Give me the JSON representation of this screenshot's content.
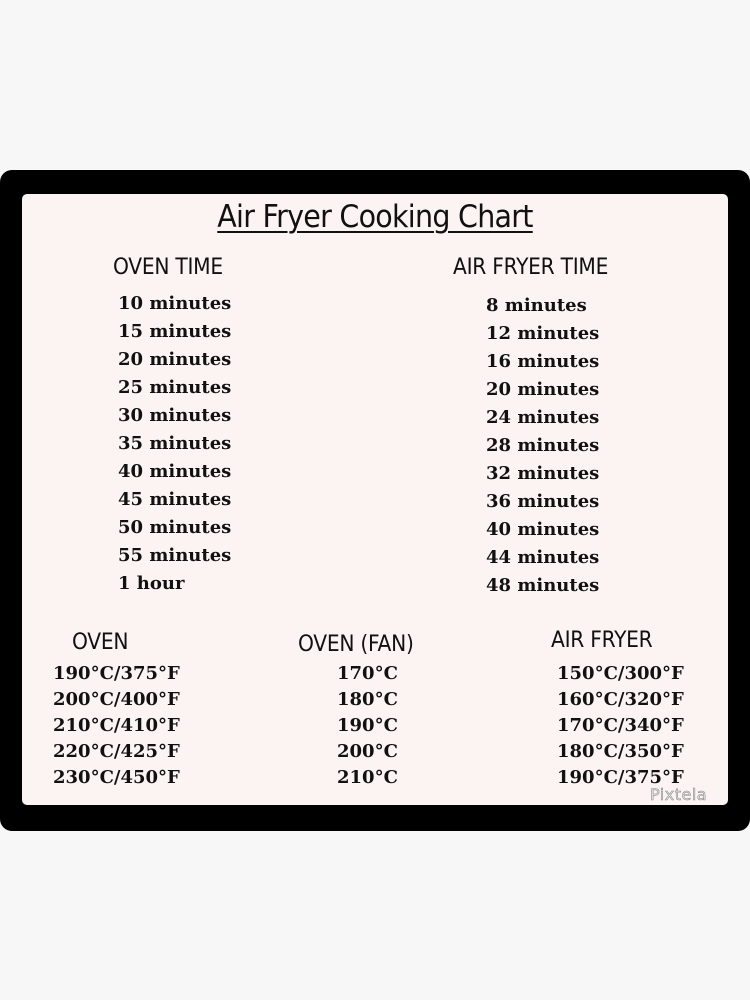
{
  "title": "Air Fryer Cooking Chart",
  "time_section": {
    "oven_heading": "OVEN TIME",
    "air_fryer_heading": "AIR FRYER TIME",
    "oven_times": [
      "10 minutes",
      "15 minutes",
      "20 minutes",
      "25 minutes",
      "30 minutes",
      "35 minutes",
      "40 minutes",
      "45 minutes",
      "50 minutes",
      "55 minutes",
      "1 hour"
    ],
    "air_fryer_times": [
      "8 minutes",
      "12 minutes",
      "16 minutes",
      "20 minutes",
      "24 minutes",
      "28 minutes",
      "32 minutes",
      "36 minutes",
      "40 minutes",
      "44 minutes",
      "48 minutes"
    ]
  },
  "temperature_section": {
    "oven_heading": "OVEN",
    "oven_fan_heading": "OVEN (FAN)",
    "air_fryer_heading": "AIR FRYER",
    "oven_temps": [
      "190°C/375°F",
      "200°C/400°F",
      "210°C/410°F",
      "220°C/425°F",
      "230°C/450°F"
    ],
    "oven_fan_temps": [
      "170°C",
      "180°C",
      "190°C",
      "200°C",
      "210°C"
    ],
    "air_fryer_temps": [
      "150°C/300°F",
      "160°C/320°F",
      "170°C/340°F",
      "180°C/350°F",
      "190°C/375°F"
    ]
  },
  "watermark": "Pixtela",
  "colors": {
    "page_background": "#f7f7f7",
    "frame": "#000000",
    "panel": "#fcf4f2",
    "text": "#111111"
  }
}
